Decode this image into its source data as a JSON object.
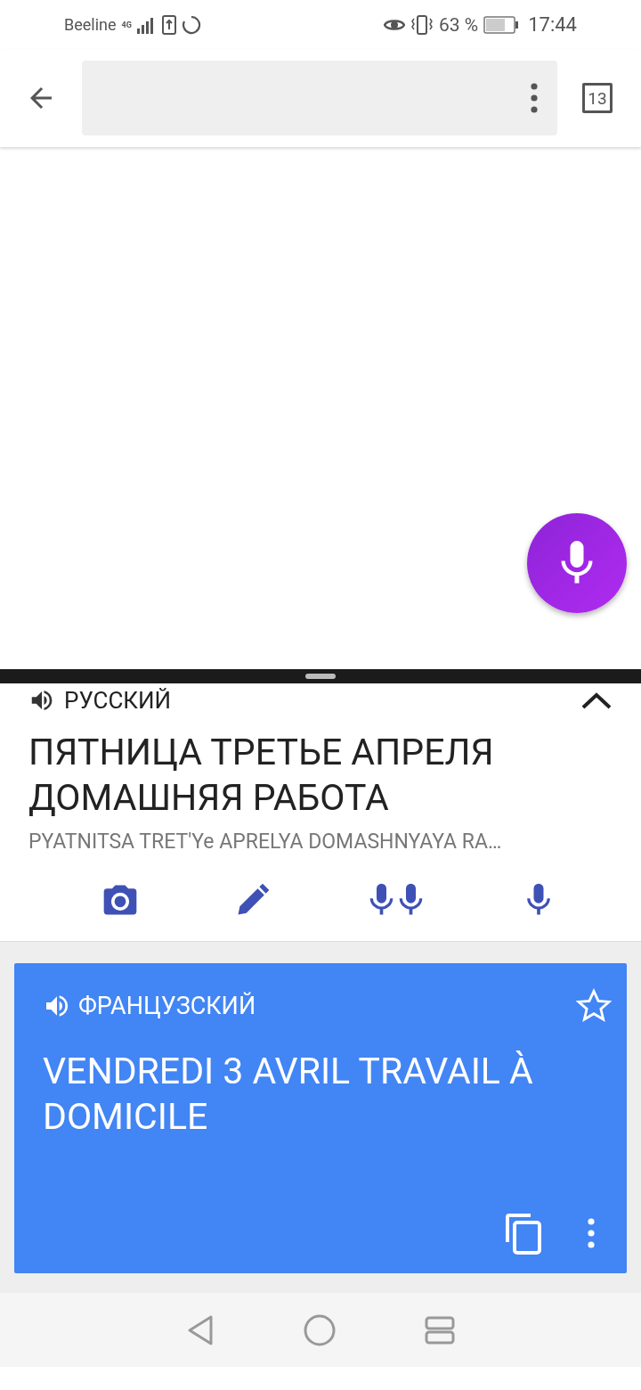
{
  "status_bar": {
    "carrier": "Beeline",
    "network": "4G",
    "battery": "63 %",
    "time": "17:44"
  },
  "toolbar": {
    "tab_count": "13"
  },
  "source": {
    "language": "РУССКИЙ",
    "text": "ПЯТНИЦА ТРЕТЬЕ АПРЕЛЯ ДОМАШНЯЯ РАБОТА",
    "transliteration": "PYATNITSA TRET'Ye APRELYA DOMASHNYAYA RA…"
  },
  "result": {
    "language": "ФРАНЦУЗСКИЙ",
    "text": "VENDREDI 3 AVRIL TRAVAIL À DOMICILE",
    "starred": false
  }
}
